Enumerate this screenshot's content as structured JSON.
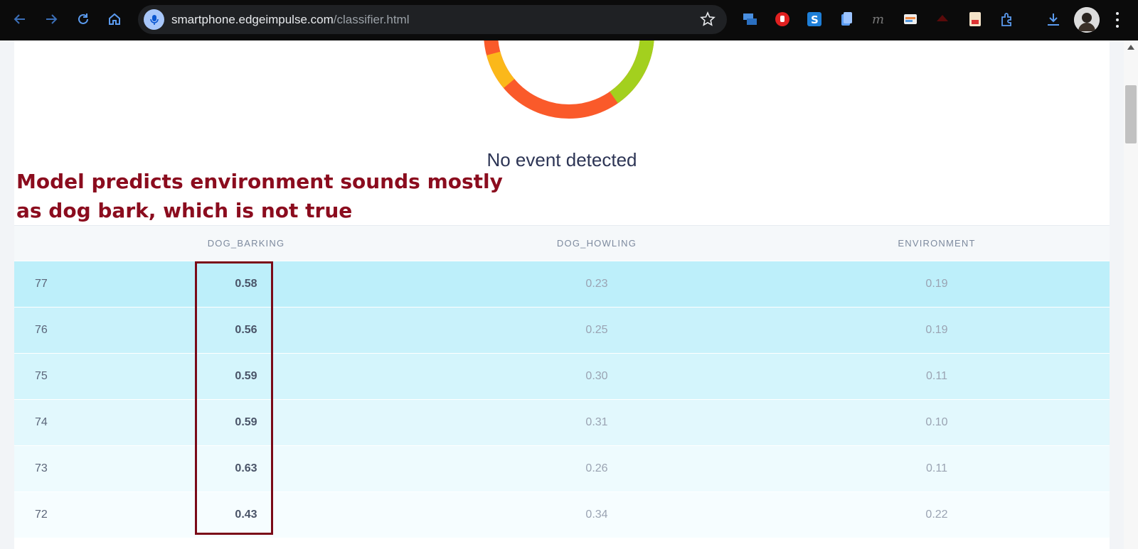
{
  "browser": {
    "url_host": "smartphone.edgeimpulse.com",
    "url_path": "/classifier.html",
    "icons": [
      "back-arrow-icon",
      "forward-arrow-icon",
      "reload-icon",
      "home-icon",
      "microphone-icon",
      "bookmark-star-icon",
      "download-icon",
      "kebab-menu-icon"
    ]
  },
  "classifier": {
    "status": "No event detected",
    "annotation_line1": "Model predicts environment sounds mostly",
    "annotation_line2": "as dog bark, which is not true",
    "columns": [
      "DOG_BARKING",
      "DOG_HOWLING",
      "ENVIRONMENT"
    ],
    "rows": [
      {
        "idx": "77",
        "dog_barking": "0.58",
        "dog_howling": "0.23",
        "environment": "0.19"
      },
      {
        "idx": "76",
        "dog_barking": "0.56",
        "dog_howling": "0.25",
        "environment": "0.19"
      },
      {
        "idx": "75",
        "dog_barking": "0.59",
        "dog_howling": "0.30",
        "environment": "0.11"
      },
      {
        "idx": "74",
        "dog_barking": "0.59",
        "dog_howling": "0.31",
        "environment": "0.10"
      },
      {
        "idx": "73",
        "dog_barking": "0.63",
        "dog_howling": "0.26",
        "environment": "0.11"
      },
      {
        "idx": "72",
        "dog_barking": "0.43",
        "dog_howling": "0.34",
        "environment": "0.22"
      }
    ],
    "row_colors": [
      "#bdeffa",
      "#c9f2fb",
      "#d4f5fc",
      "#e2f8fd",
      "#eefbfe",
      "#f6fdff"
    ],
    "donut_colors": {
      "barking": "#fa5a2a",
      "howling": "#a3d01e",
      "environment": "#fbb81a"
    }
  }
}
